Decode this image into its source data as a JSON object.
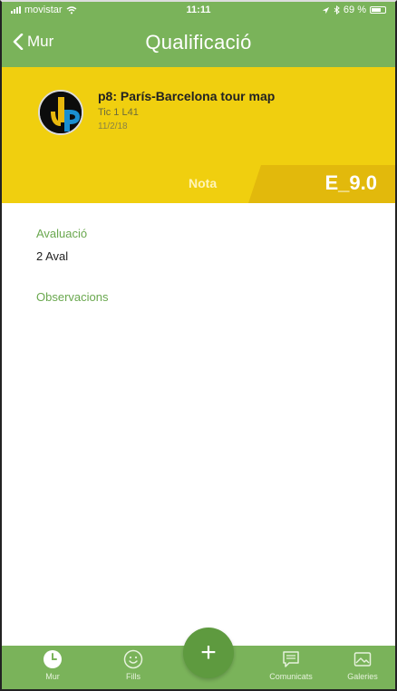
{
  "status_bar": {
    "carrier": "movistar",
    "time": "11:11",
    "battery": "69 %"
  },
  "nav": {
    "back_label": "Mur",
    "title": "Qualificació"
  },
  "activity": {
    "title": "p8: París-Barcelona tour map",
    "group": "Tic 1 L41",
    "date": "11/2/18",
    "grade_label": "Nota",
    "grade_value": "E_9.0"
  },
  "details": {
    "evaluation_label": "Avaluació",
    "evaluation_value": "2 Aval",
    "observations_label": "Observacions"
  },
  "tabbar": {
    "items": [
      {
        "label": "Mur",
        "icon": "clock-icon"
      },
      {
        "label": "Fills",
        "icon": "smiley-icon"
      },
      {
        "label": "Comunicats",
        "icon": "message-icon"
      },
      {
        "label": "Galeries",
        "icon": "image-icon"
      }
    ],
    "add_icon": "plus-icon",
    "add_label": "+"
  },
  "colors": {
    "primary_green": "#7ab35a",
    "header_yellow": "#f0cf0f",
    "grade_yellow": "#e2b90c",
    "label_green": "#6aa84f"
  }
}
